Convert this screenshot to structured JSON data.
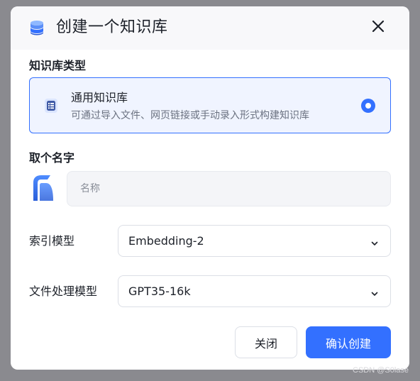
{
  "dialog": {
    "title": "创建一个知识库",
    "close_icon": "close-icon",
    "header_icon": "database-icon"
  },
  "kb_type": {
    "label": "知识库类型",
    "option": {
      "title": "通用知识库",
      "description": "可通过导入文件、网页链接或手动录入形式构建知识库",
      "selected": true,
      "icon": "document-list-icon"
    }
  },
  "name_section": {
    "label": "取个名字",
    "avatar_icon": "app-logo-icon",
    "input": {
      "value": "",
      "placeholder": "名称"
    }
  },
  "index_model": {
    "label": "索引模型",
    "value": "Embedding-2"
  },
  "file_model": {
    "label": "文件处理模型",
    "value": "GPT35-16k"
  },
  "buttons": {
    "cancel": "关闭",
    "confirm": "确认创建"
  },
  "watermark": "CSDN @S0lase",
  "colors": {
    "primary": "#3370ff",
    "card_bg": "#f0f4ff",
    "overlay": "#8a8a8f"
  }
}
